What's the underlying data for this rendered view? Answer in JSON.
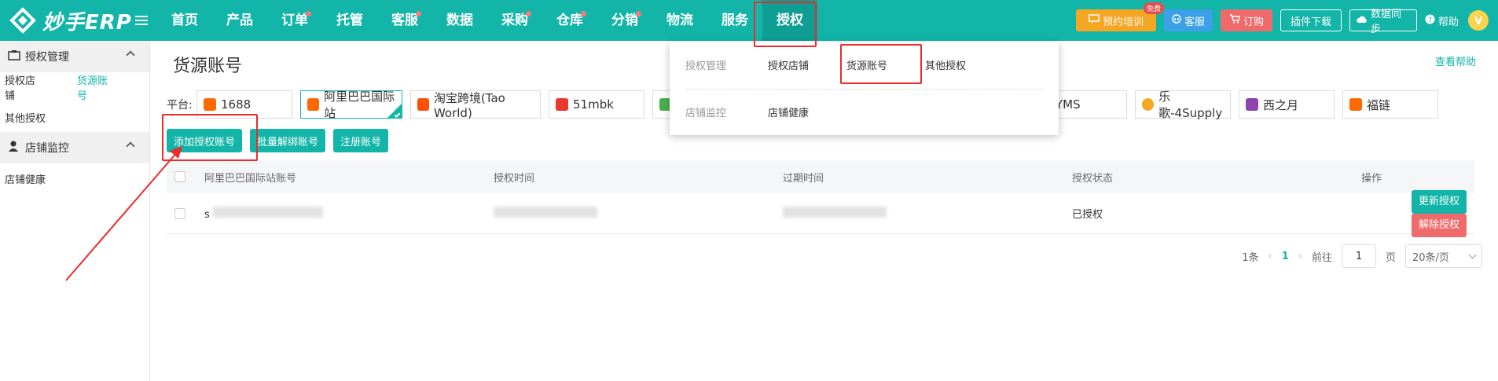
{
  "brand": {
    "name": "妙手ERP",
    "accent": "#12b5a8"
  },
  "nav": {
    "items": [
      {
        "label": "首页",
        "dot": false
      },
      {
        "label": "产品",
        "dot": false
      },
      {
        "label": "订单",
        "dot": true
      },
      {
        "label": "托管",
        "dot": false
      },
      {
        "label": "客服",
        "dot": true
      },
      {
        "label": "数据",
        "dot": false
      },
      {
        "label": "采购",
        "dot": true
      },
      {
        "label": "仓库",
        "dot": true
      },
      {
        "label": "分销",
        "dot": true
      },
      {
        "label": "物流",
        "dot": false
      },
      {
        "label": "服务",
        "dot": false
      },
      {
        "label": "授权",
        "dot": false
      }
    ],
    "active": "授权"
  },
  "toolbar": {
    "training_label": "预约培训",
    "free_badge": "免费",
    "service_label": "客服",
    "order_label": "订购",
    "plugin_label": "插件下载",
    "sync_label": "数据同步",
    "help_label": "帮助"
  },
  "sidebar": {
    "groups": [
      {
        "title": "授权管理",
        "items": [
          "授权店铺",
          "货源账号",
          "其他授权"
        ]
      },
      {
        "title": "店铺监控",
        "items": [
          "店铺健康"
        ]
      }
    ],
    "active_item": "货源账号"
  },
  "page": {
    "title": "货源账号",
    "help_link": "查看帮助",
    "platform_label": "平台:",
    "platforms": [
      {
        "name": "1688",
        "icon_color": "#ff6a00",
        "selected": false
      },
      {
        "name": "阿里巴巴国际站",
        "icon_color": "#ff6a00",
        "selected": true
      },
      {
        "name": "淘宝跨境(Tao World)",
        "icon_color": "#ff5000",
        "selected": false
      },
      {
        "name": "51mbk",
        "icon_color": "#e8382f",
        "selected": false
      },
      {
        "name": "",
        "icon_color": "#4caf50",
        "selected": false
      },
      {
        "name": "YMS",
        "icon_color": "#e84c3d",
        "selected": false
      },
      {
        "name": "乐歌-4Supply",
        "icon_color": "#f5a623",
        "selected": false
      },
      {
        "name": "西之月",
        "icon_color": "#8e44ad",
        "selected": false
      },
      {
        "name": "福链",
        "icon_color": "#ff6a00",
        "selected": false
      }
    ],
    "buttons": {
      "add": "添加授权账号",
      "unbind": "批量解绑账号",
      "register": "注册账号"
    },
    "table": {
      "columns": [
        "阿里巴巴国际站账号",
        "授权时间",
        "过期时间",
        "授权状态",
        "操作"
      ],
      "rows": [
        {
          "account": "s",
          "auth_time": "",
          "expire_time": "",
          "status": "已授权",
          "actions": [
            "更新授权",
            "解除授权"
          ]
        }
      ]
    },
    "pagination": {
      "total": "1条",
      "current": "1",
      "goto_label": "前往",
      "goto_value": "1",
      "page_unit": "页",
      "page_size": "20条/页"
    }
  },
  "dropdown": {
    "rows": [
      {
        "label": "授权管理",
        "items": [
          "授权店铺",
          "货源账号",
          "其他授权"
        ]
      },
      {
        "label": "店铺监控",
        "items": [
          "店铺健康"
        ]
      }
    ]
  }
}
